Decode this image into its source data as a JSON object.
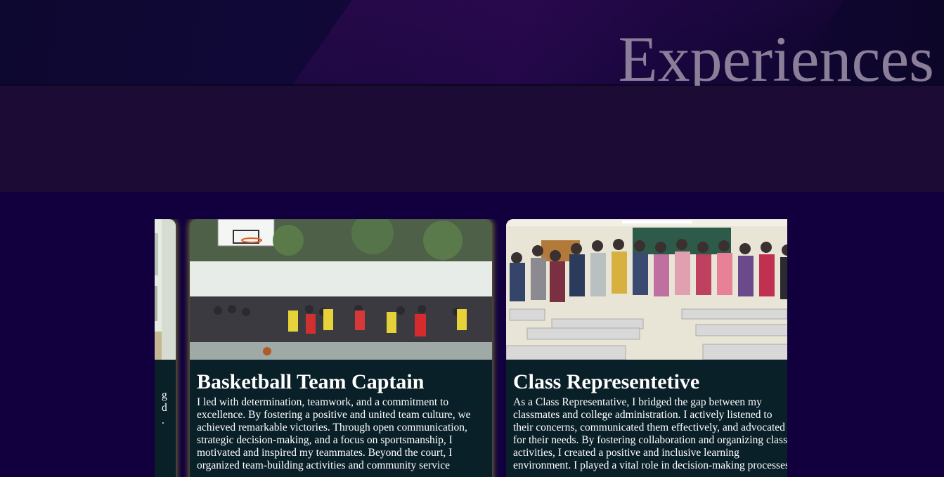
{
  "section": {
    "title": "Experiences"
  },
  "cards": [
    {
      "title": "",
      "text_fragment_lines": [
        "g",
        "d",
        "."
      ],
      "photo_icon": "store-photo"
    },
    {
      "title": "Basketball Team Captain",
      "body_lines": [
        "I led with determination, teamwork, and a commitment to",
        "excellence. By fostering a positive and united team culture, we",
        "achieved remarkable victories. Through open communication,",
        "strategic decision-making, and a focus on sportsmanship, I",
        "motivated and inspired my teammates. Beyond the court, I",
        "organized team-building activities and community service"
      ],
      "photo_icon": "basketball-game-photo"
    },
    {
      "title": "Class Representetive",
      "body_lines": [
        "As a Class Representative, I bridged the gap between my",
        "classmates and college administration. I actively listened to",
        "their concerns, communicated them effectively, and advocated",
        "for their needs. By fostering collaboration and organizing class",
        "activities, I created a positive and inclusive learning",
        "environment. I played a vital role in decision-making processes"
      ],
      "photo_icon": "class-group-photo"
    }
  ],
  "colors": {
    "page_background": "#12003e",
    "card_background": "#0a2028",
    "card_glow": "#bec828",
    "title_color": "#8a7e98"
  }
}
